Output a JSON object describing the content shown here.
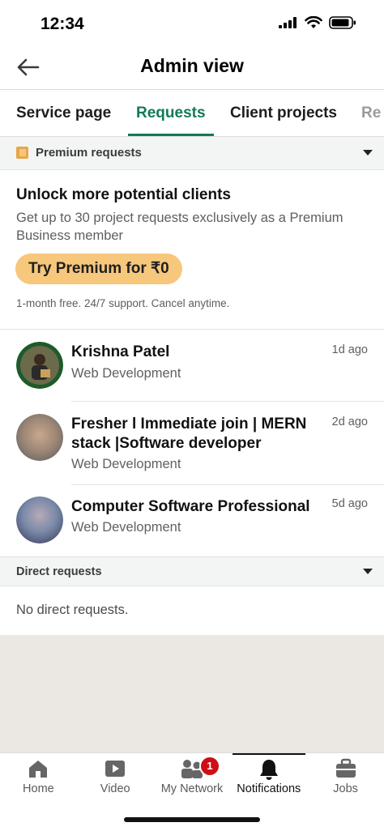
{
  "status_bar": {
    "time": "12:34"
  },
  "header": {
    "title": "Admin view"
  },
  "tabs": [
    {
      "label": "Service page"
    },
    {
      "label": "Requests"
    },
    {
      "label": "Client projects"
    },
    {
      "label": "Re"
    }
  ],
  "premium_section": {
    "label": "Premium requests",
    "headline": "Unlock more potential clients",
    "body": "Get up to 30 project requests exclusively as a Premium Business member",
    "button": "Try Premium for ₹0",
    "note": "1-month free. 24/7 support. Cancel anytime."
  },
  "requests": [
    {
      "name": "Krishna Patel",
      "category": "Web Development",
      "time": "1d ago"
    },
    {
      "name": "Fresher l Immediate join | MERN stack |Software developer",
      "category": "Web Development",
      "time": "2d ago"
    },
    {
      "name": "Computer Software Professional",
      "category": "Web Development",
      "time": "5d ago"
    }
  ],
  "direct_section": {
    "label": "Direct requests",
    "empty": "No direct requests."
  },
  "bottom_nav": [
    {
      "label": "Home",
      "icon": "home-icon"
    },
    {
      "label": "Video",
      "icon": "video-icon"
    },
    {
      "label": "My Network",
      "icon": "network-icon",
      "badge": "1"
    },
    {
      "label": "Notifications",
      "icon": "bell-icon"
    },
    {
      "label": "Jobs",
      "icon": "briefcase-icon"
    }
  ],
  "colors": {
    "accent": "#117a5b",
    "premium": "#f7c77c",
    "badge": "#cc1016"
  }
}
